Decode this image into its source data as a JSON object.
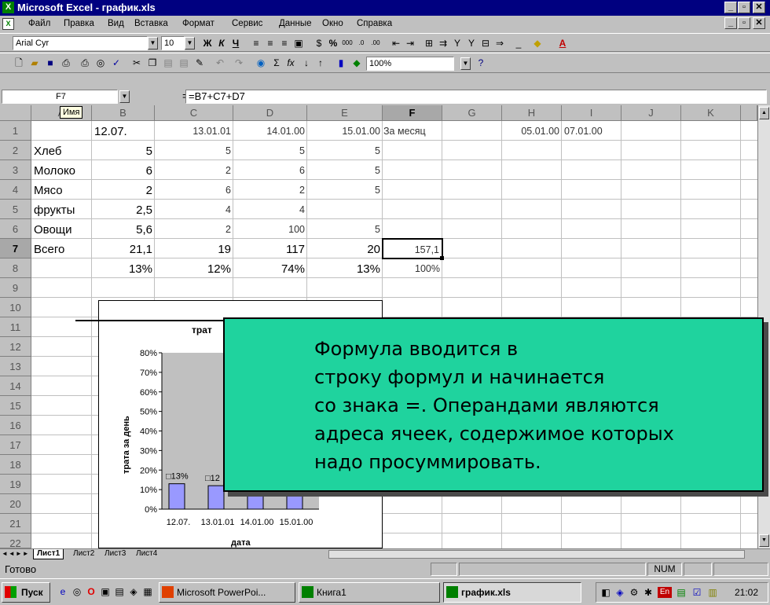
{
  "window": {
    "title": "Microsoft Excel - график.xls",
    "app_icon": "excel-icon"
  },
  "menu": [
    "Файл",
    "Правка",
    "Вид",
    "Вставка",
    "Формат",
    "Сервис",
    "Данные",
    "Окно",
    "Справка"
  ],
  "format_toolbar": {
    "font": "Arial Cyr",
    "size": "10",
    "zoom": "100%"
  },
  "formula_bar": {
    "name_box": "F7",
    "name_tooltip": "Имя",
    "equals": "=",
    "formula": "=B7+C7+D7"
  },
  "columns": [
    "A",
    "B",
    "C",
    "D",
    "E",
    "F",
    "G",
    "H",
    "I",
    "J",
    "K"
  ],
  "rows": [
    "1",
    "2",
    "3",
    "4",
    "5",
    "6",
    "7",
    "8",
    "9",
    "10",
    "11",
    "12",
    "13",
    "14",
    "15",
    "16",
    "17",
    "18",
    "19",
    "20",
    "21",
    "22"
  ],
  "cells": {
    "B1": "12.07.",
    "C1": "13.01.01",
    "D1": "14.01.00",
    "E1": "15.01.00",
    "F1": "За месяц",
    "H1": "05.01.00",
    "I1": "07.01.00",
    "A2": "Хлеб",
    "B2": "5",
    "C2": "5",
    "D2": "5",
    "E2": "5",
    "A3": "Молоко",
    "B3": "6",
    "C3": "2",
    "D3": "6",
    "E3": "5",
    "A4": "Мясо",
    "B4": "2",
    "C4": "6",
    "D4": "2",
    "E4": "5",
    "A5": "фрукты",
    "B5": "2,5",
    "C5": "4",
    "D5": "4",
    "A6": "Овощи",
    "B6": "5,6",
    "C6": "2",
    "D6": "100",
    "E6": "5",
    "A7": "Всего",
    "B7": "21,1",
    "C7": "19",
    "D7": "117",
    "E7": "20",
    "F7": "157,1",
    "B8": "13%",
    "C8": "12%",
    "D8": "74%",
    "E8": "13%",
    "F8": "100%"
  },
  "chart": {
    "title_fragment": "трат",
    "ylabel": "трата за день",
    "xlabel": "дата",
    "y_ticks": [
      "80%",
      "70%",
      "60%",
      "50%",
      "40%",
      "30%",
      "20%",
      "10%",
      "0%"
    ],
    "x_ticks": [
      "12.07.",
      "13.01.01",
      "14.01.00",
      "15.01.00"
    ],
    "data_labels": [
      "13%",
      "12"
    ],
    "bar_color": "#9999ff",
    "plot_bg": "#c0c0c0"
  },
  "chart_data": {
    "type": "bar",
    "categories": [
      "12.07.",
      "13.01.01",
      "14.01.00",
      "15.01.00"
    ],
    "values": [
      0.13,
      0.12,
      0.74,
      0.13
    ],
    "xlabel": "дата",
    "ylabel": "трата за день",
    "ylim": [
      0,
      0.8
    ],
    "grid": false
  },
  "callout": {
    "lines": [
      "Формула вводится в",
      "строку формул и начинается",
      "со знака =. Операндами являются",
      "адреса ячеек, содержимое которых",
      "надо просуммировать."
    ],
    "color": "#1fd39e"
  },
  "sheet_tabs": [
    "Лист1",
    "Лист2",
    "Лист3",
    "Лист4"
  ],
  "status": {
    "ready": "Готово",
    "num": "NUM"
  },
  "taskbar": {
    "start": "Пуск",
    "tasks": [
      "Microsoft PowerPoi...",
      "Книга1",
      "график.xls"
    ],
    "active_task": "график.xls",
    "clock": "21:02",
    "lang": "En"
  }
}
